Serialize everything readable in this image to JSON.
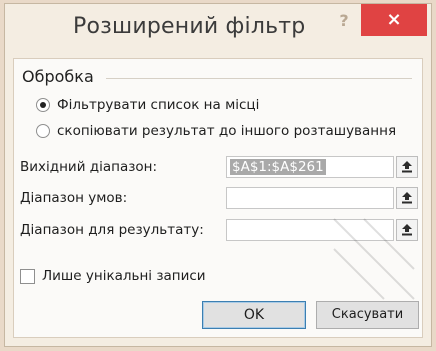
{
  "window": {
    "title": "Розширений фільтр",
    "help_label": "?",
    "close_label": "×"
  },
  "processing": {
    "label": "Обробка",
    "options": [
      {
        "label": "Фільтрувати список на місці",
        "selected": true
      },
      {
        "label": "скопіювати результат до іншого розташування",
        "selected": false
      }
    ]
  },
  "fields": {
    "source_range": {
      "label": "Вихідний діапазон:",
      "value": "$A$1:$A$261"
    },
    "criteria_range": {
      "label": "Діапазон умов:",
      "value": ""
    },
    "result_range": {
      "label": "Діапазон для результату:",
      "value": ""
    }
  },
  "unique_only": {
    "label": "Лише унікальні записи",
    "checked": false
  },
  "buttons": {
    "ok": "OK",
    "cancel": "Скасувати"
  },
  "colors": {
    "close_bg": "#e04343",
    "selection": "#a9a9a9",
    "frame": "#f4ede2"
  }
}
